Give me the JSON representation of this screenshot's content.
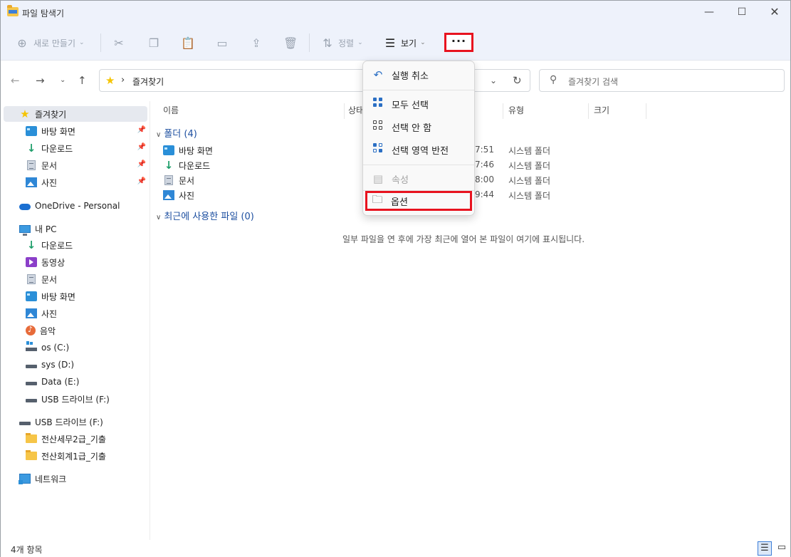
{
  "window": {
    "title": "파일 탐색기",
    "min": "—",
    "max": "☐",
    "close": "✕"
  },
  "toolbar": {
    "new_label": "새로 만들기",
    "sort_label": "정렬",
    "view_label": "보기",
    "more_label": "···"
  },
  "address": {
    "path": "즐겨찾기"
  },
  "search": {
    "placeholder": "즐겨찾기 검색"
  },
  "sidebar": {
    "favorites": "즐겨찾기",
    "fav_items": [
      "바탕 화면",
      "다운로드",
      "문서",
      "사진"
    ],
    "onedrive": "OneDrive - Personal",
    "pc": "내 PC",
    "pc_items": [
      "다운로드",
      "동영상",
      "문서",
      "바탕 화면",
      "사진",
      "음악",
      "os (C:)",
      "sys (D:)",
      "Data (E:)",
      "USB 드라이브 (F:)"
    ],
    "usb": "USB 드라이브 (F:)",
    "usb_items": [
      "전산세무2급_기출",
      "전산회계1급_기출"
    ],
    "network": "네트워크"
  },
  "columns": {
    "name": "이름",
    "status": "상태",
    "type": "유형",
    "size": "크기"
  },
  "groups": {
    "folders": "폴더 (4)",
    "recent": "최근에 사용한 파일 (0)"
  },
  "rows": [
    {
      "name": "바탕 화면",
      "date": "7:51",
      "type": "시스템 폴더"
    },
    {
      "name": "다운로드",
      "date": "7:46",
      "type": "시스템 폴더"
    },
    {
      "name": "문서",
      "date": "8:00",
      "type": "시스템 폴더"
    },
    {
      "name": "사진",
      "date": "9:44",
      "type": "시스템 폴더"
    }
  ],
  "empty_message": "일부 파일을 연 후에 가장 최근에 열어 본 파일이 여기에 표시됩니다.",
  "status": {
    "count": "4개 항목"
  },
  "menu": {
    "undo": "실행 취소",
    "select_all": "모두 선택",
    "select_none": "선택 안 함",
    "invert": "선택 영역 반전",
    "properties": "속성",
    "options": "옵션"
  },
  "colors": {
    "highlight": "#e8131f",
    "accent": "#2b6fc4"
  }
}
